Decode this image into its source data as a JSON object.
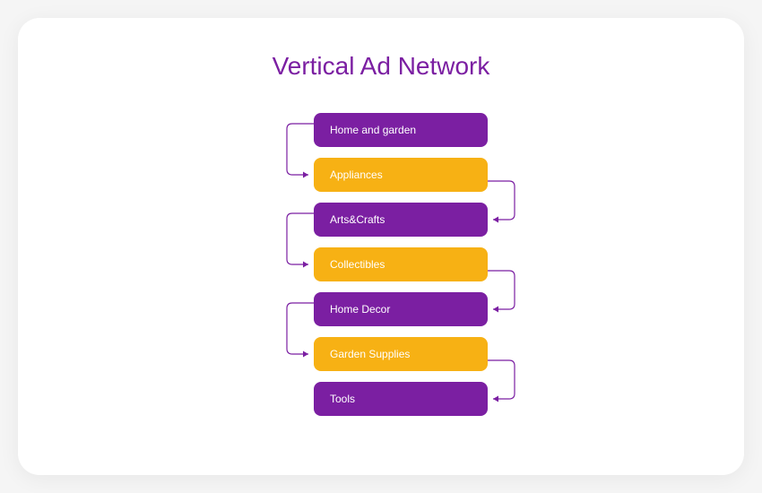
{
  "title": "Vertical Ad Network",
  "colors": {
    "purple": "#7b1fa2",
    "yellow": "#f7b114"
  },
  "nodes": [
    {
      "label": "Home and garden",
      "color": "purple"
    },
    {
      "label": "Appliances",
      "color": "yellow"
    },
    {
      "label": "Arts&Crafts",
      "color": "purple"
    },
    {
      "label": "Collectibles",
      "color": "yellow"
    },
    {
      "label": "Home Decor",
      "color": "purple"
    },
    {
      "label": "Garden Supplies",
      "color": "yellow"
    },
    {
      "label": "Tools",
      "color": "purple"
    }
  ]
}
